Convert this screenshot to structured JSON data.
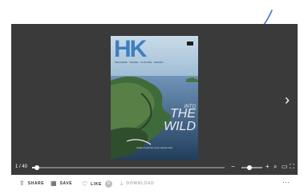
{
  "cover": {
    "masthead": "HK",
    "tagline": "MAGAZINE · TRAVEL · CULTURE · DESIGN",
    "kicker": "INTO",
    "headline": "THE WILD",
    "footer": "Hidden beaches and coastal trails"
  },
  "viewer": {
    "next_icon": "chevron-right-icon",
    "page_counter": "1 / 40",
    "progress_fraction": 0.025,
    "zoom_fraction": 0.4
  },
  "controls": {
    "zoom_out": "−",
    "zoom_in": "+",
    "search": "⌕",
    "single_page": "▭",
    "fullscreen": "⛶"
  },
  "actions": {
    "share_label": "SHARE",
    "save_label": "SAVE",
    "like_label": "LIKE",
    "like_count": "0",
    "download_label": "DOWNLOAD",
    "more": "···"
  },
  "colors": {
    "viewer_bg": "#3a3a3a",
    "annotation": "#4a74c9"
  }
}
